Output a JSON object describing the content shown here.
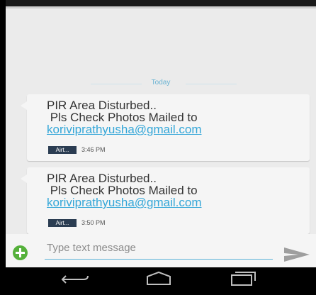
{
  "conversation": {
    "date_divider": "Today",
    "messages": [
      {
        "line1": "PIR Area Disturbed..",
        "line2": " Pls Check Photos Mailed to",
        "email": "koriviprathyusha@gmail.com",
        "sim": "Airt...",
        "time": "3:46 PM"
      },
      {
        "line1": "PIR Area Disturbed..",
        "line2": " Pls Check Photos Mailed to",
        "email": "koriviprathyusha@gmail.com",
        "sim": "Airt...",
        "time": "3:50 PM"
      }
    ]
  },
  "compose": {
    "placeholder": "Type text message",
    "value": ""
  },
  "colors": {
    "link": "#33a6d8",
    "accent_line": "#5bb3d9",
    "add_button": "#55b13b",
    "sim_badge": "#2b3d52"
  },
  "icons": {
    "add": "plus-circle-icon",
    "send": "send-icon",
    "back": "back-icon",
    "home": "home-icon",
    "recent": "recent-apps-icon"
  }
}
